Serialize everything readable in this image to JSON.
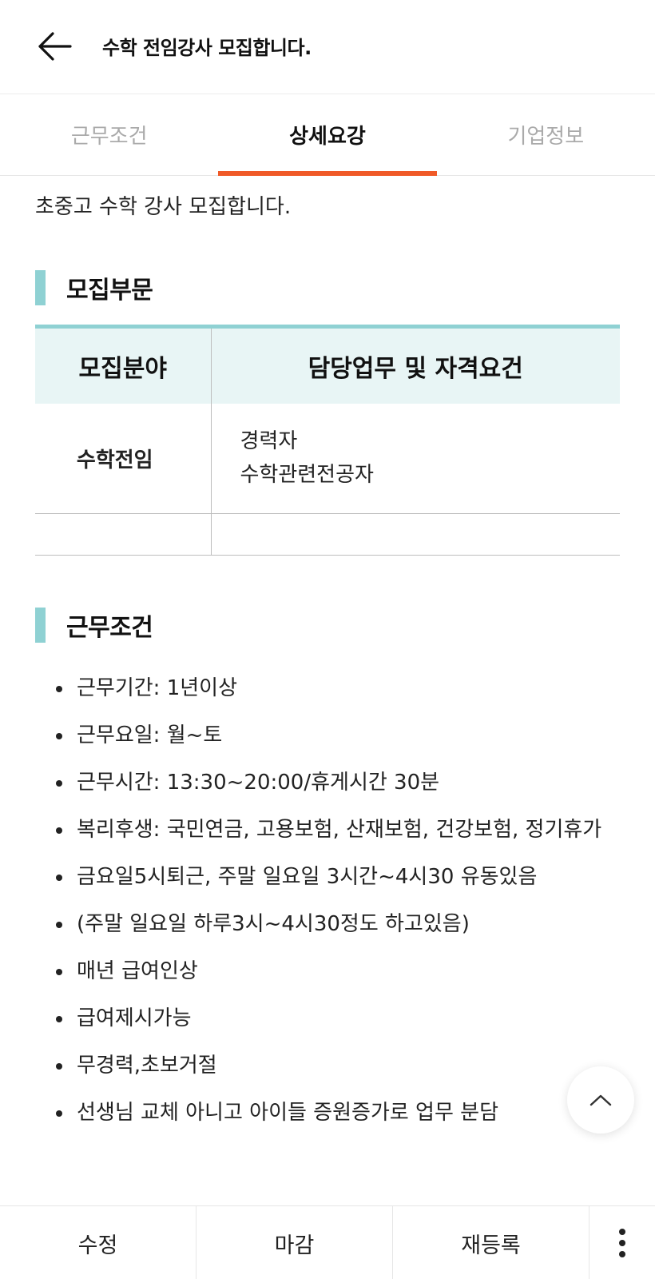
{
  "header": {
    "title": "수학 전임강사 모집합니다.",
    "back_icon": "arrow-left-icon"
  },
  "tabs": [
    {
      "label": "근무조건",
      "active": false
    },
    {
      "label": "상세요강",
      "active": true
    },
    {
      "label": "기업정보",
      "active": false
    }
  ],
  "intro": "초중고 수학 강사 모집합니다.",
  "recruit_section": {
    "title": "모집부문",
    "columns": [
      "모집분야",
      "담당업무 및 자격요건"
    ],
    "rows": [
      {
        "field": "수학전임",
        "duties": [
          "경력자",
          "수학관련전공자"
        ]
      }
    ]
  },
  "conditions_section": {
    "title": "근무조건",
    "items": [
      "근무기간: 1년이상",
      "근무요일: 월~토",
      "근무시간: 13:30~20:00/휴게시간 30분",
      "복리후생: 국민연금, 고용보험, 산재보험, 건강보험, 정기휴가",
      "금요일5시퇴근, 주말 일요일 3시간~4시30 유동있음",
      "(주말 일요일 하루3시~4시30정도 하고있음)",
      "매년 급여인상",
      "급여제시가능",
      "무경력,초보거절",
      "선생님 교체 아니고 아이들 증원증가로 업무 분담"
    ]
  },
  "bottom_bar": {
    "edit_label": "수정",
    "close_label": "마감",
    "repost_label": "재등록",
    "more_icon": "more-vertical-icon"
  },
  "colors": {
    "accent": "#f05a28",
    "section_bar": "#8fd1d3",
    "table_header_bg": "#e8f5f5"
  }
}
